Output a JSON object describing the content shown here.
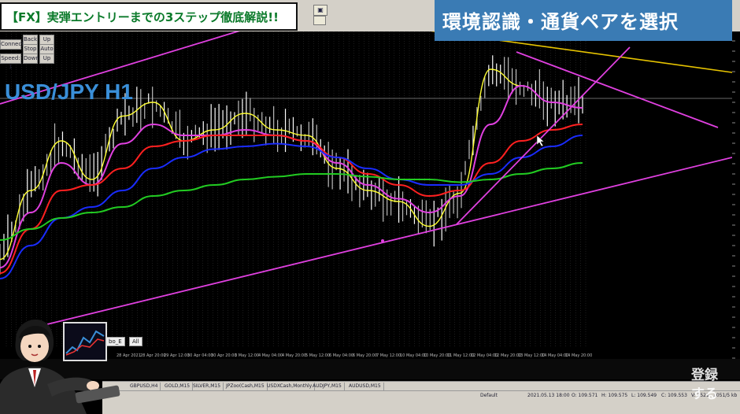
{
  "title_banner": "【FX】実弾エントリーまでの3ステップ徹底解説!!",
  "step_banner": "環境認識・通貨ペアを選択",
  "pair_label": "USD/JPY H1",
  "controls": {
    "connect": "Connect",
    "back": "Back",
    "up": "Up",
    "stop": "Stop",
    "auto": "Auto",
    "speed": "Speed: 1",
    "down": "Down",
    "up2": "Up"
  },
  "chart_buttons": {
    "combo": "bo_E",
    "all": "All"
  },
  "time_axis": [
    "28 Apr 2021",
    "28 Apr 20:00",
    "29 Apr 12:00",
    "30 Apr 04:00",
    "30 Apr 20:00",
    "3 May 12:00",
    "4 May 04:00",
    "4 May 20:00",
    "5 May 12:00",
    "6 May 04:00",
    "6 May 20:00",
    "7 May 12:00",
    "10 May 04:00",
    "10 May 20:00",
    "11 May 12:00",
    "12 May 04:00",
    "12 May 20:00",
    "13 May 12:00",
    "14 May 04:00",
    "14 May 20:00"
  ],
  "right_axis_label": "スプレッド",
  "tabs": [
    "GBPUSD,H4",
    "GOLD,M15",
    "SILVER,M15",
    "JPZoo(Cash,M15",
    "USDXCash,Monthly",
    "AUDJPY,M15",
    "AUDUSD,M15"
  ],
  "status": {
    "profile": "Default",
    "datetime": "2021.05.13 18:00",
    "open": "O: 109.571",
    "high": "H: 109.575",
    "low": "L: 109.549",
    "close": "C: 109.553",
    "volume": "V: 2521",
    "traffic": "1051/5 kb"
  },
  "signup": [
    "登録",
    "する"
  ],
  "colors": {
    "ma_yellow": "#ffff33",
    "ma_magenta": "#e040e0",
    "ma_red": "#ff2020",
    "ma_blue": "#1a2cff",
    "ma_green": "#22cc22",
    "trendline": "#e040e0",
    "horizontal_line": "#e6c300",
    "title_text": "#0a7a2a",
    "step_bg": "#3a7bb4",
    "pair_text": "#3a8fd8"
  },
  "chart_data": {
    "type": "line",
    "title": "USD/JPY H1",
    "xlabel": "",
    "ylabel": "",
    "categories": [
      "28 Apr 2021",
      "28 Apr 20:00",
      "29 Apr 12:00",
      "30 Apr 04:00",
      "30 Apr 20:00",
      "3 May 12:00",
      "4 May 04:00",
      "4 May 20:00",
      "5 May 12:00",
      "6 May 04:00",
      "6 May 20:00",
      "7 May 12:00",
      "10 May 04:00",
      "10 May 20:00",
      "11 May 12:00",
      "12 May 04:00",
      "12 May 20:00",
      "13 May 12:00",
      "14 May 04:00",
      "14 May 20:00"
    ],
    "series": [
      {
        "name": "",
        "values": [
          0.23,
          0.48,
          0.66,
          0.52,
          0.75,
          0.8,
          0.66,
          0.7,
          0.76,
          0.7,
          0.68,
          0.56,
          0.48,
          0.44,
          0.35,
          0.47,
          0.92,
          0.86,
          0.8,
          0.78
        ]
      },
      {
        "name": "",
        "values": [
          0.2,
          0.4,
          0.58,
          0.5,
          0.65,
          0.72,
          0.68,
          0.68,
          0.7,
          0.68,
          0.66,
          0.58,
          0.5,
          0.45,
          0.4,
          0.46,
          0.72,
          0.86,
          0.8,
          0.78
        ]
      },
      {
        "name": "",
        "values": [
          0.18,
          0.34,
          0.48,
          0.5,
          0.56,
          0.64,
          0.66,
          0.68,
          0.68,
          0.68,
          0.66,
          0.6,
          0.54,
          0.5,
          0.46,
          0.48,
          0.58,
          0.66,
          0.7,
          0.72
        ]
      },
      {
        "name": "",
        "values": [
          0.16,
          0.28,
          0.38,
          0.42,
          0.48,
          0.56,
          0.6,
          0.63,
          0.64,
          0.65,
          0.64,
          0.6,
          0.56,
          0.52,
          0.5,
          0.5,
          0.54,
          0.6,
          0.64,
          0.68
        ]
      },
      {
        "name": "",
        "values": [
          0.3,
          0.34,
          0.38,
          0.4,
          0.42,
          0.46,
          0.48,
          0.5,
          0.52,
          0.53,
          0.54,
          0.54,
          0.53,
          0.52,
          0.52,
          0.51,
          0.52,
          0.54,
          0.56,
          0.58
        ]
      }
    ],
    "ylim": [
      0,
      1
    ],
    "grid": true
  }
}
